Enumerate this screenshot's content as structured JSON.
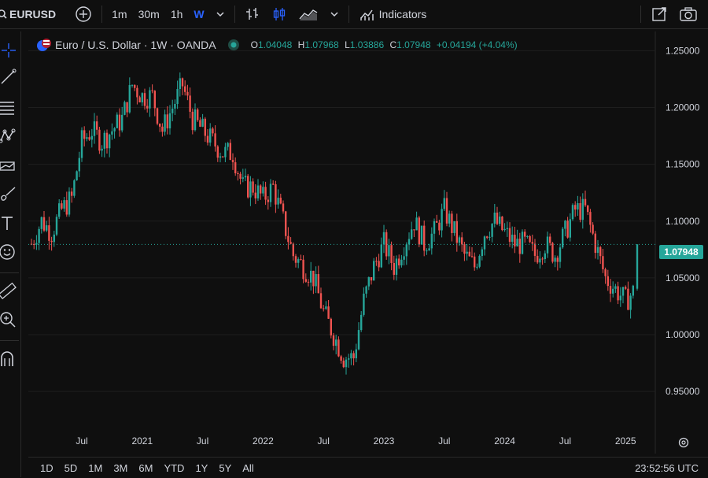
{
  "toolbar": {
    "symbol": "EURUSD",
    "intervals": [
      "1m",
      "30m",
      "1h",
      "W"
    ],
    "active_interval": "W",
    "indicators_label": "Indicators"
  },
  "legend": {
    "title": "Euro / U.S. Dollar · 1W · OANDA",
    "o_label": "O",
    "o_value": "1.04048",
    "h_label": "H",
    "h_value": "1.07968",
    "l_label": "L",
    "l_value": "1.03886",
    "c_label": "C",
    "c_value": "1.07948",
    "change": "+0.04194 (+4.04%)"
  },
  "price_axis": {
    "ticks": [
      "1.25000",
      "1.20000",
      "1.15000",
      "1.10000",
      "1.05000",
      "1.00000",
      "0.95000"
    ],
    "last_price": "1.07948"
  },
  "time_axis": {
    "ticks": [
      "Jul",
      "2021",
      "Jul",
      "2022",
      "Jul",
      "2023",
      "Jul",
      "2024",
      "Jul",
      "2025"
    ]
  },
  "ranges": [
    "1D",
    "5D",
    "1M",
    "3M",
    "6M",
    "YTD",
    "1Y",
    "5Y",
    "All"
  ],
  "clock": "23:52:56 UTC",
  "colors": {
    "up": "#26a69a",
    "down": "#ef5350",
    "background": "#0f0f0f",
    "accent": "#2962ff"
  },
  "chart_data": {
    "type": "candlestick",
    "ylim": [
      0.93,
      1.26
    ],
    "x": [
      "2020-02",
      "2020-03",
      "2020-04",
      "2020-05",
      "2020-06",
      "2020-07",
      "2020-08",
      "2020-09",
      "2020-10",
      "2020-11",
      "2020-12",
      "2021-01",
      "2021-02",
      "2021-03",
      "2021-04",
      "2021-05",
      "2021-06",
      "2021-07",
      "2021-08",
      "2021-09",
      "2021-10",
      "2021-11",
      "2021-12",
      "2022-01",
      "2022-02",
      "2022-03",
      "2022-04",
      "2022-05",
      "2022-06",
      "2022-07",
      "2022-08",
      "2022-09",
      "2022-10",
      "2022-11",
      "2022-12",
      "2023-01",
      "2023-02",
      "2023-03",
      "2023-04",
      "2023-05",
      "2023-06",
      "2023-07",
      "2023-08",
      "2023-09",
      "2023-10",
      "2023-11",
      "2023-12",
      "2024-01",
      "2024-02",
      "2024-03",
      "2024-04",
      "2024-05",
      "2024-06",
      "2024-07",
      "2024-08",
      "2024-09",
      "2024-10",
      "2024-11",
      "2024-12",
      "2025-01",
      "2025-02"
    ],
    "values": [
      1.08,
      1.1,
      1.09,
      1.11,
      1.12,
      1.17,
      1.18,
      1.17,
      1.18,
      1.19,
      1.22,
      1.21,
      1.21,
      1.18,
      1.2,
      1.22,
      1.19,
      1.18,
      1.17,
      1.16,
      1.16,
      1.13,
      1.13,
      1.12,
      1.13,
      1.1,
      1.07,
      1.06,
      1.05,
      1.02,
      1.0,
      0.98,
      0.98,
      1.03,
      1.06,
      1.08,
      1.06,
      1.08,
      1.1,
      1.08,
      1.09,
      1.11,
      1.09,
      1.07,
      1.06,
      1.09,
      1.1,
      1.09,
      1.08,
      1.08,
      1.07,
      1.08,
      1.07,
      1.09,
      1.11,
      1.11,
      1.08,
      1.05,
      1.04,
      1.03,
      1.04
    ],
    "last": 1.07948
  }
}
